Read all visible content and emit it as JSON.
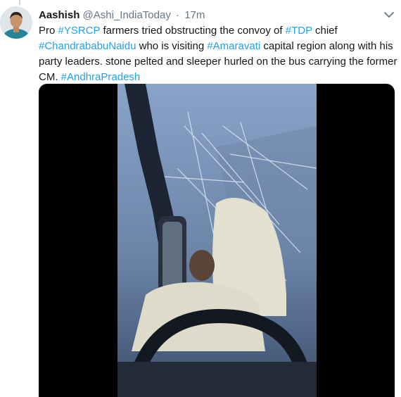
{
  "tweet": {
    "author_name": "Aashish",
    "handle": "@Ashi_IndiaToday",
    "separator": "·",
    "time": "17m",
    "segments": [
      {
        "t": "Pro ",
        "link": false
      },
      {
        "t": "#YSRCP",
        "link": true
      },
      {
        "t": " farmers tried obstructing the convoy of ",
        "link": false
      },
      {
        "t": "#TDP",
        "link": true
      },
      {
        "t": " chief ",
        "link": false
      },
      {
        "t": "#ChandrababuNaidu",
        "link": true
      },
      {
        "t": " who is visiting ",
        "link": false
      },
      {
        "t": "#Amaravati",
        "link": true
      },
      {
        "t": " capital region along with his party leaders. stone pelted and sleeper hurled on the bus carrying the former CM. ",
        "link": false
      },
      {
        "t": "#AndhraPradesh",
        "link": true
      }
    ]
  },
  "icons": {
    "more": "chevron-down-icon",
    "avatar": "user-avatar"
  },
  "colors": {
    "link": "#1da1f2",
    "secondary_text": "#657786",
    "primary_text": "#14171a"
  }
}
